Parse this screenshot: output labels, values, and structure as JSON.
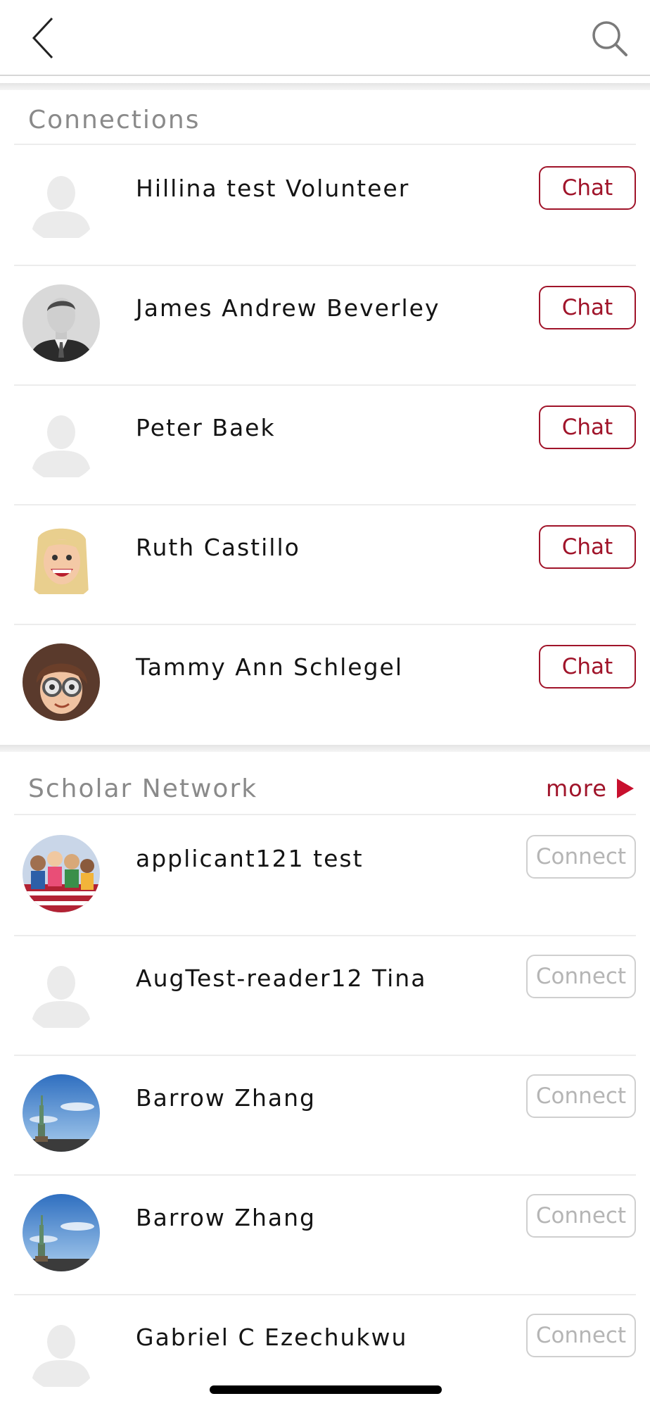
{
  "header": {
    "back_icon": "chevron-left-icon",
    "search_icon": "search-icon"
  },
  "connections": {
    "title": "Connections",
    "people": [
      {
        "name": "Hillina test Volunteer",
        "avatar": "placeholder",
        "action": "Chat"
      },
      {
        "name": "James Andrew Beverley",
        "avatar": "photo-suit",
        "action": "Chat"
      },
      {
        "name": "Peter Baek",
        "avatar": "placeholder",
        "action": "Chat"
      },
      {
        "name": "Ruth Castillo",
        "avatar": "cartoon-blonde",
        "action": "Chat"
      },
      {
        "name": "Tammy Ann Schlegel",
        "avatar": "cartoon-glasses",
        "action": "Chat"
      }
    ]
  },
  "scholar_network": {
    "title": "Scholar Network",
    "more_label": "more",
    "people": [
      {
        "name": "applicant121 test",
        "avatar": "photo-group",
        "action": "Connect"
      },
      {
        "name": "AugTest-reader12 Tina",
        "avatar": "placeholder",
        "action": "Connect"
      },
      {
        "name": "Barrow Zhang",
        "avatar": "photo-statue",
        "action": "Connect"
      },
      {
        "name": "Barrow Zhang",
        "avatar": "photo-statue",
        "action": "Connect"
      },
      {
        "name": "Gabriel C Ezechukwu",
        "avatar": "placeholder",
        "action": "Connect"
      }
    ]
  },
  "colors": {
    "accent": "#a0142a",
    "arrow": "#c8102e",
    "section_title": "#8a8a8a",
    "connect_border": "#cfcfcf"
  }
}
